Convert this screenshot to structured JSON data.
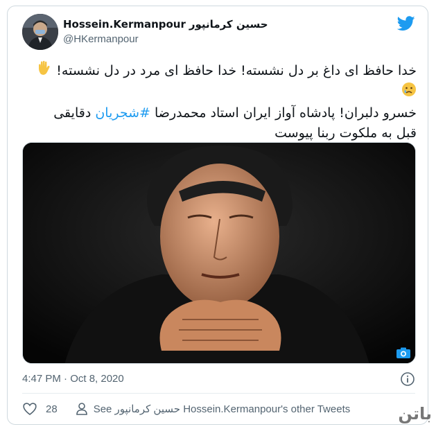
{
  "author": {
    "display_name": "Hossein.Kermanpour",
    "display_name_fa": "حسین کرمانپور",
    "handle": "@HKermanpour",
    "avatar": "person-portrait-icon"
  },
  "tweet": {
    "line1": "خدا حافظ ای داغ بر دل نشسته! خدا حافظ ای مرد در دل نشسته!",
    "emoji1": "waving-hand-icon",
    "emoji2": "crying-face-icon",
    "line2_start": "خسرو دلبران! پادشاه آواز ایران استاد محمدرضا",
    "hashtag": "#شجریان",
    "line2_end": "دقایقی",
    "line3": "قبل به ملکوت ربنا پیوست"
  },
  "media": {
    "type": "photo",
    "icon": "camera-icon"
  },
  "meta": {
    "timestamp": "4:47 PM · Oct 8, 2020",
    "info_icon": "info-icon"
  },
  "actions": {
    "like_count": "28",
    "see_tweets": "See حسین کرمانپور Hossein.Kermanpour's other Tweets"
  },
  "watermark": "باتن",
  "colors": {
    "accent": "#1d9bf0",
    "text": "#0f1419",
    "secondary": "#536471",
    "border": "#cfd9de"
  }
}
